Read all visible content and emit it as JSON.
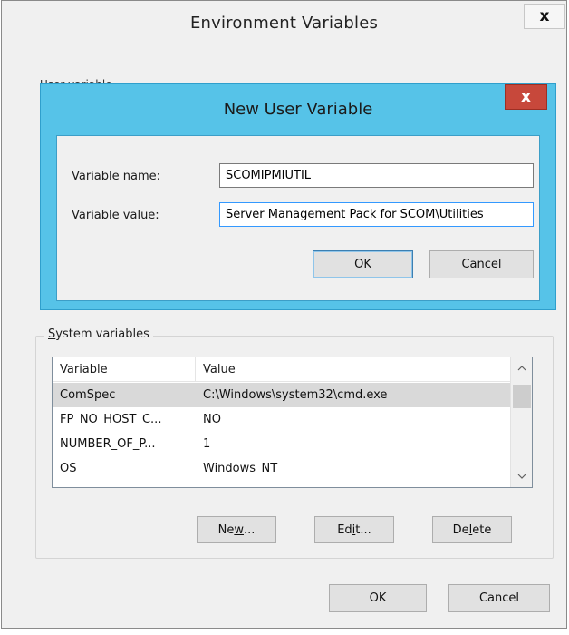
{
  "env_window": {
    "title": "Environment Variables",
    "close_glyph": "x",
    "user_vars_label_partial": "User variables for Administrator"
  },
  "new_user_variable": {
    "title": "New User Variable",
    "close_glyph": "x",
    "name_label_pre": "Variable ",
    "name_label_key": "n",
    "name_label_post": "ame:",
    "name_value": "SCOMIPMIUTIL",
    "value_label_pre": "Variable ",
    "value_label_key": "v",
    "value_label_post": "alue:",
    "value_value": "Server Management Pack for SCOM\\Utilities",
    "ok_label": "OK",
    "cancel_label": "Cancel"
  },
  "system_variables": {
    "group_label_key": "S",
    "group_label_rest": "ystem variables",
    "columns": [
      "Variable",
      "Value"
    ],
    "rows": [
      {
        "variable": "ComSpec",
        "value": "C:\\Windows\\system32\\cmd.exe",
        "selected": true
      },
      {
        "variable": "FP_NO_HOST_C...",
        "value": "NO",
        "selected": false
      },
      {
        "variable": "NUMBER_OF_P...",
        "value": "1",
        "selected": false
      },
      {
        "variable": "OS",
        "value": "Windows_NT",
        "selected": false
      }
    ],
    "new_pre": "Ne",
    "new_key": "w",
    "new_post": "...",
    "edit_pre": "Ed",
    "edit_key": "i",
    "edit_post": "t...",
    "delete_pre": "De",
    "delete_key": "l",
    "delete_post": "ete"
  },
  "footer": {
    "ok_label": "OK",
    "cancel_label": "Cancel"
  },
  "icons": {
    "close": "close-icon",
    "scroll_up": "chevron-up-icon",
    "scroll_down": "chevron-down-icon"
  },
  "colors": {
    "dialog_accent": "#56c3e8",
    "close_red": "#c7483b",
    "selected_row": "#d9d9d9"
  }
}
